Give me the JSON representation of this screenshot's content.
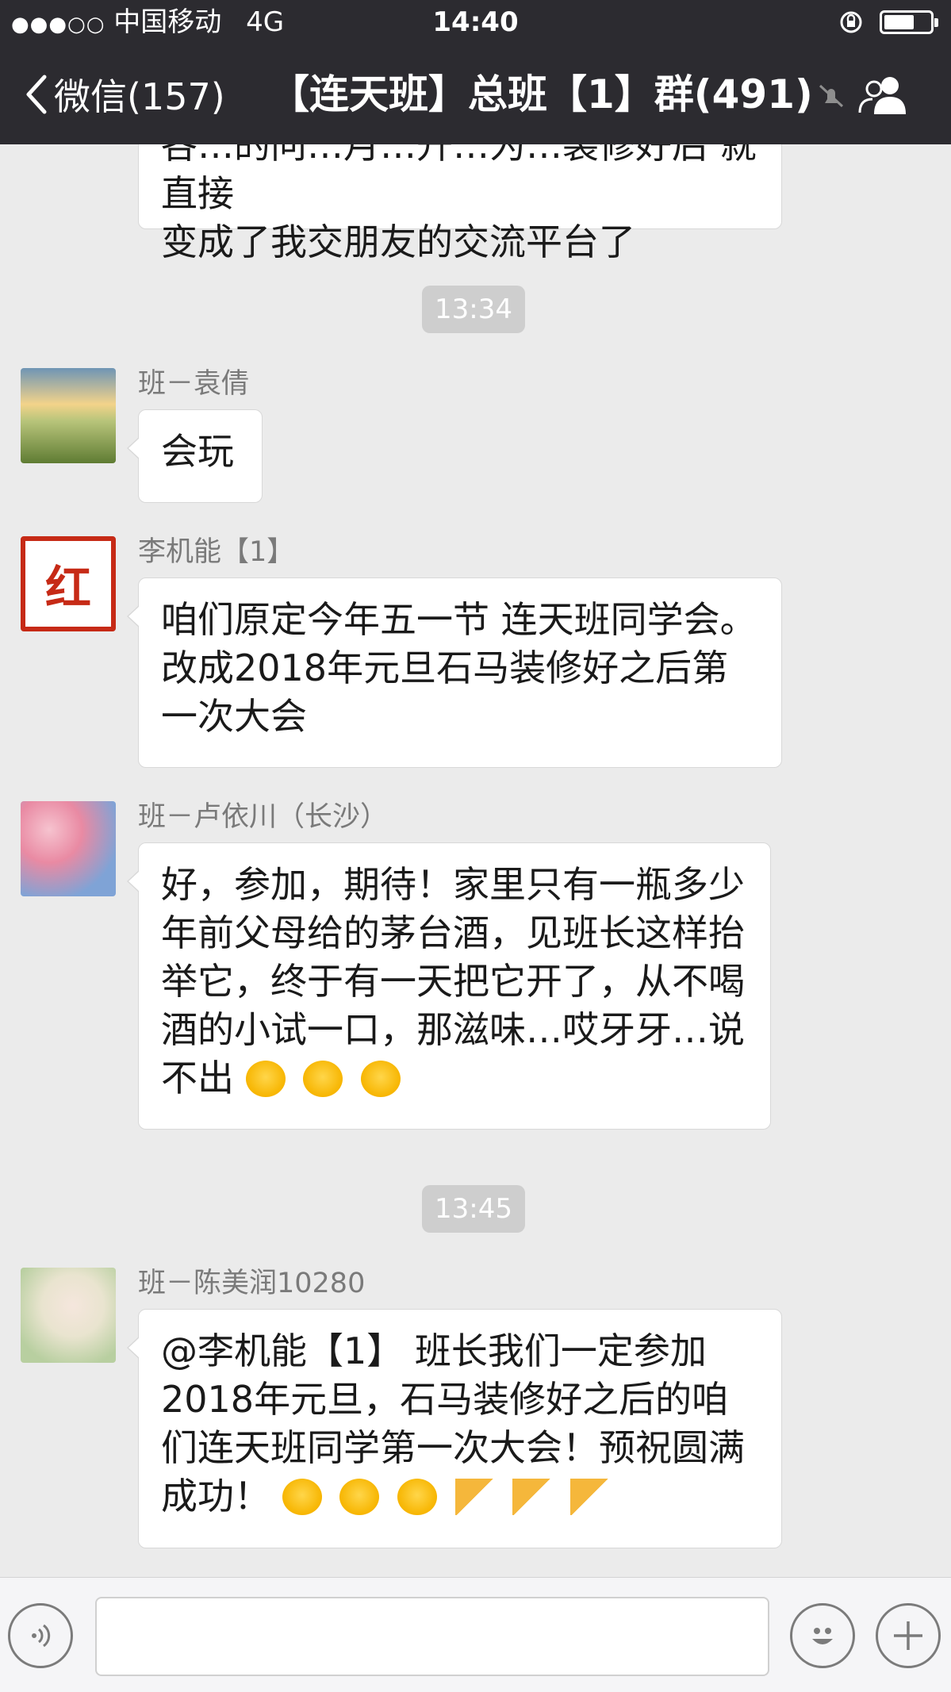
{
  "status_bar": {
    "signal_dots": "●●●○○",
    "carrier": "中国移动",
    "network": "4G",
    "time": "14:40",
    "battery_level": 0.6
  },
  "nav": {
    "back_label": "微信(157)",
    "title": "【连天班】总班【1】群(491)",
    "icons": [
      "chevron-left-icon",
      "mute-icon",
      "members-icon"
    ]
  },
  "messages": {
    "m0_text_line1": "各…的问…月…升…为…装修好后 就直接",
    "m0_text_line2": "变成了我交朋友的交流平台了",
    "time1": "13:34",
    "m1_sender": "班－袁倩",
    "m1_text": "会玩",
    "m2_sender": "李机能【1】",
    "m2_avatar_text": "红",
    "m2_text": "咱们原定今年五一节 连天班同学会。改成2018年元旦石马装修好之后第一次大会",
    "m3_sender": "班－卢依川（长沙）",
    "m3_text": "好，参加，期待！家里只有一瓶多少年前父母给的茅台酒，见班长这样抬举它，终于有一天把它开了，从不喝酒的小试一口，那滋味…哎牙牙…说不出",
    "time2": "13:45",
    "m4_sender": "班－陈美润10280",
    "m4_text": "@李机能【1】 班长我们一定参加2018年元旦，石马装修好之后的咱们连天班同学第一次大会！预祝圆满成功！"
  },
  "input_bar": {
    "icons": [
      "voice-icon",
      "emoji-icon",
      "plus-icon"
    ],
    "placeholder": ""
  },
  "colors": {
    "nav_bg": "#2c2b30",
    "chat_bg": "#ebebeb",
    "bubble_bg": "#ffffff",
    "time_pill": "#cecece"
  }
}
